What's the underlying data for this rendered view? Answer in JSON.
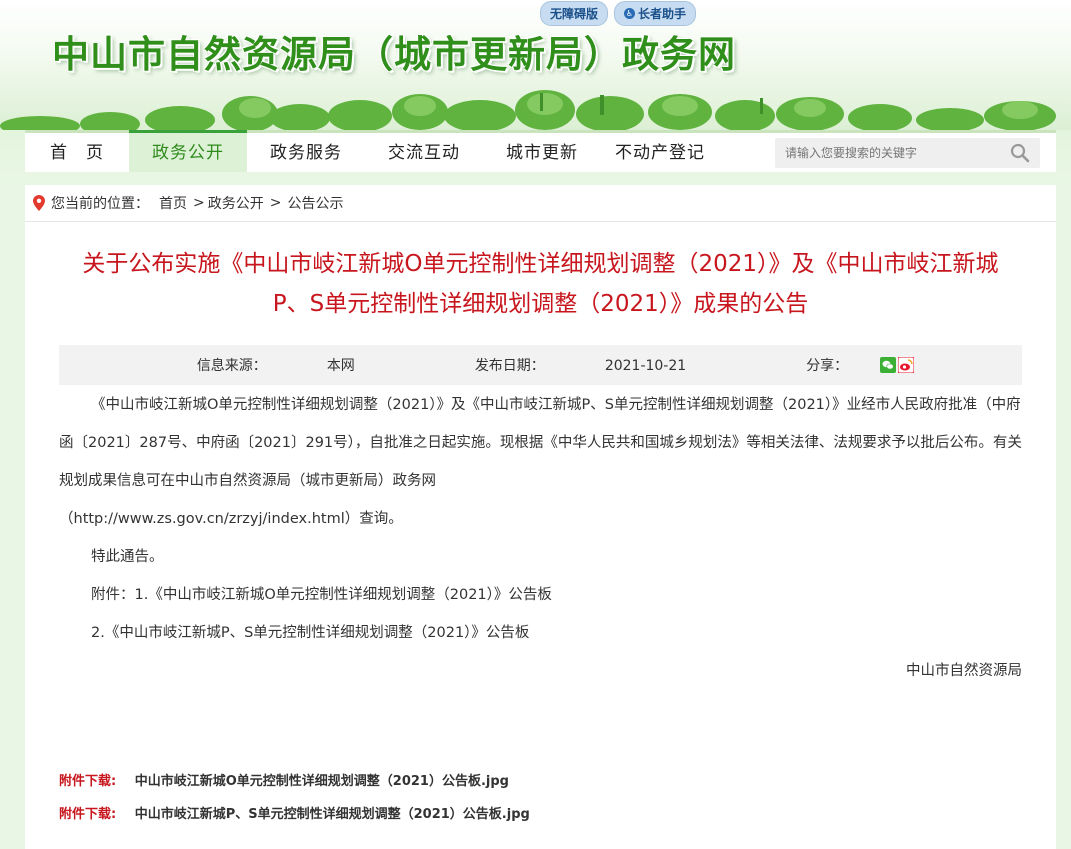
{
  "header": {
    "site_title": "中山市自然资源局（城市更新局）政务网",
    "accessibility_label": "无障碍版",
    "elderly_label": "长者助手"
  },
  "nav": {
    "items": [
      {
        "label": "首　页"
      },
      {
        "label": "政务公开",
        "active": true
      },
      {
        "label": "政务服务"
      },
      {
        "label": "交流互动"
      },
      {
        "label": "城市更新"
      },
      {
        "label": "不动产登记"
      }
    ],
    "search_placeholder": "请输入您要搜索的关键字"
  },
  "breadcrumb": {
    "prefix": "您当前的位置：",
    "path": [
      "首页",
      "政务公开",
      "公告公示"
    ],
    "separator": ">"
  },
  "article": {
    "title": "关于公布实施《中山市岐江新城O单元控制性详细规划调整（2021）》及《中山市岐江新城P、S单元控制性详细规划调整（2021）》成果的公告",
    "source_label": "信息来源：",
    "source_value": "本网",
    "date_label": "发布日期：",
    "date_value": "2021-10-21",
    "share_label": "分享：",
    "paragraphs": [
      "《中山市岐江新城O单元控制性详细规划调整（2021）》及《中山市岐江新城P、S单元控制性详细规划调整（2021）》业经市人民政府批准（中府函〔2021〕287号、中府函〔2021〕291号），自批准之日起实施。现根据《中华人民共和国城乡规划法》等相关法律、法规要求予以批后公布。有关规划成果信息可在中山市自然资源局（城市更新局）政务网",
      "（http://www.zs.gov.cn/zrzyj/index.html）查询。",
      "特此通告。",
      "附件：1.《中山市岐江新城O单元控制性详细规划调整（2021）》公告板",
      "2.《中山市岐江新城P、S单元控制性详细规划调整（2021）》公告板"
    ],
    "signature": "中山市自然资源局"
  },
  "downloads": {
    "label": "附件下载:",
    "files": [
      "中山市岐江新城O单元控制性详细规划调整（2021）公告板.jpg",
      "中山市岐江新城P、S单元控制性详细规划调整（2021）公告板.jpg"
    ]
  },
  "colors": {
    "title_green": "#2f8f1a",
    "article_red": "#c7161d",
    "nav_active_bg": "#ddf1d6"
  }
}
